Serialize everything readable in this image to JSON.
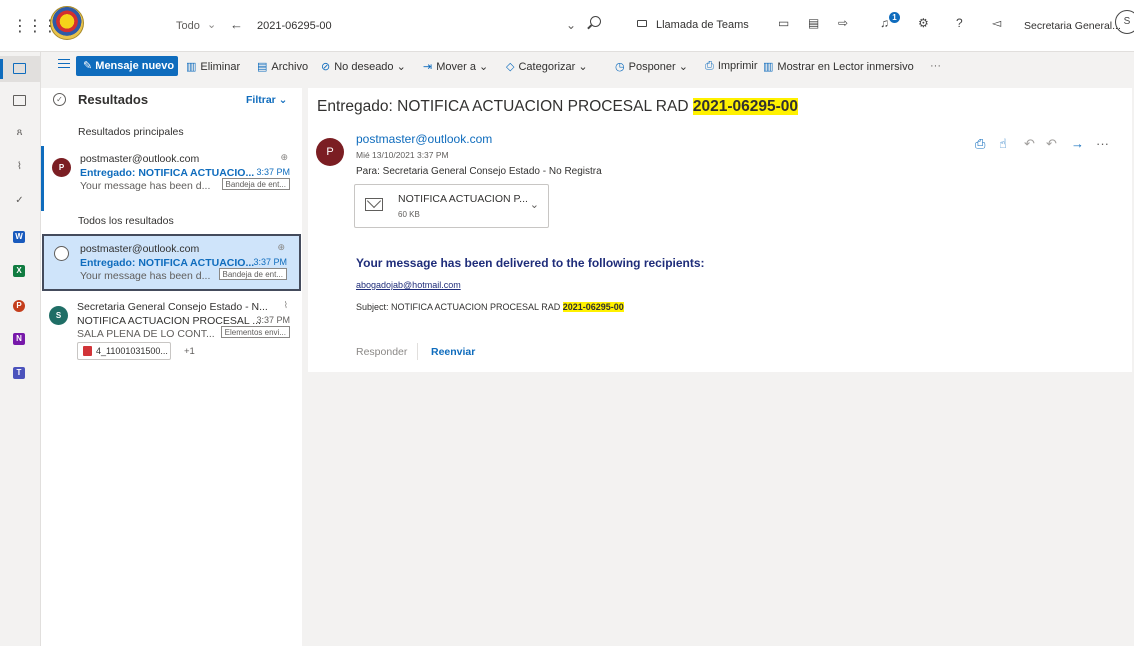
{
  "topbar": {
    "search_scope": "Todo",
    "search_query": "2021-06295-00",
    "teams_label": "Llamada de Teams",
    "notification_count": "1",
    "help_label": "?",
    "user_name": "Secretaria General...",
    "user_initial": "S"
  },
  "toolbar": {
    "new_message": "Mensaje nuevo",
    "delete": "Eliminar",
    "archive": "Archivo",
    "junk": "No deseado",
    "move": "Mover a",
    "categorize": "Categorizar",
    "snooze": "Posponer",
    "print": "Imprimir",
    "immersive": "Mostrar en Lector inmersivo",
    "more": "···"
  },
  "list": {
    "title": "Resultados",
    "filter": "Filtrar",
    "top_results_header": "Resultados principales",
    "all_results_header": "Todos los resultados",
    "items": [
      {
        "avatar": "P",
        "from": "postmaster@outlook.com",
        "subject": "Entregado: NOTIFICA ACTUACIO...",
        "time": "3:37 PM",
        "preview": "Your message has been d...",
        "folder": "Bandeja de ent..."
      },
      {
        "from": "postmaster@outlook.com",
        "subject": "Entregado: NOTIFICA ACTUACIO...",
        "time": "3:37 PM",
        "preview": "Your message has been d...",
        "folder": "Bandeja de ent..."
      },
      {
        "avatar": "S",
        "from": "Secretaria General Consejo Estado - N...",
        "subject": "NOTIFICA ACTUACION PROCESAL ...",
        "time": "3:37 PM",
        "preview": "SALA PLENA DE LO CONT...",
        "folder": "Elementos envi...",
        "attachment": "4_11001031500...",
        "more_attachments": "+1"
      }
    ]
  },
  "reading": {
    "subject_prefix": "Entregado: NOTIFICA ACTUACION PROCESAL RAD ",
    "subject_highlight": "2021-06295-00",
    "sender_initial": "P",
    "sender": "postmaster@outlook.com",
    "date": "Mié 13/10/2021 3:37 PM",
    "to": "Para:  Secretaria General Consejo Estado - No Registra",
    "attachment_name": "NOTIFICA ACTUACION P...",
    "attachment_size": "60 KB",
    "body_title": "Your message has been delivered to the following recipients:",
    "recipient": "abogadojab@hotmail.com",
    "body_subject_prefix": "Subject: NOTIFICA ACTUACION PROCESAL RAD ",
    "body_subject_highlight": "2021-06295-00",
    "reply": "Responder",
    "forward": "Reenviar"
  },
  "colors": {
    "accent": "#0f6cbd",
    "highlight": "#fff100",
    "sender_avatar": "#7b1e23",
    "selected_item": "#cfe4fa"
  }
}
